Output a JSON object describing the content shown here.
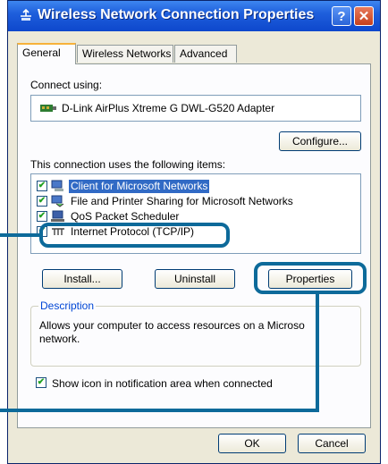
{
  "window": {
    "title": "Wireless Network Connection Properties",
    "help_button": "?",
    "close_button": "✕"
  },
  "tabs": [
    {
      "label": "General",
      "active": true
    },
    {
      "label": "Wireless Networks",
      "active": false
    },
    {
      "label": "Advanced",
      "active": false
    }
  ],
  "connect_using": {
    "label": "Connect using:",
    "adapter": "D-Link AirPlus Xtreme G DWL-G520 Adapter",
    "configure_button": "Configure..."
  },
  "components": {
    "label": "This connection uses the following items:",
    "items": [
      {
        "label": "Client for Microsoft Networks",
        "checked": true,
        "selected": true,
        "icon": "network-client-icon"
      },
      {
        "label": "File and Printer Sharing for Microsoft Networks",
        "checked": true,
        "selected": false,
        "icon": "file-printer-sharing-icon"
      },
      {
        "label": "QoS Packet Scheduler",
        "checked": true,
        "selected": false,
        "icon": "packet-scheduler-icon"
      },
      {
        "label": "Internet Protocol (TCP/IP)",
        "checked": true,
        "selected": false,
        "icon": "network-protocol-icon"
      }
    ]
  },
  "buttons": {
    "install": "Install...",
    "uninstall": "Uninstall",
    "properties": "Properties",
    "ok": "OK",
    "cancel": "Cancel"
  },
  "description": {
    "title": "Description",
    "text_line1": "Allows your computer to access resources on a Microso",
    "text_line2": "network."
  },
  "show_icon": {
    "label": "Show icon in notification area when connected",
    "checked": true
  },
  "colors": {
    "titlebar": "#0d47cc",
    "callout": "#0d6a9a",
    "selection": "#316ac5"
  }
}
